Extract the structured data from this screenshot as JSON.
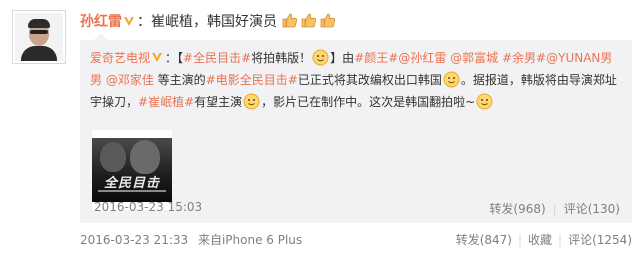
{
  "post": {
    "author": "孙红雷",
    "text": "：崔岷植，韩国好演员",
    "time": "2016-03-23 21:33",
    "source": "来自iPhone 6 Plus",
    "repost_label": "转发(847)",
    "collect_label": "收藏",
    "comment_label": "评论(1254)"
  },
  "repost": {
    "author": "爱奇艺电视",
    "segments": [
      {
        "t": "：【",
        "c": "plain"
      },
      {
        "t": "#全民目击#",
        "c": "link"
      },
      {
        "t": "将拍韩版！",
        "c": "plain"
      },
      {
        "t": "emoji",
        "c": "emoji"
      },
      {
        "t": "】由",
        "c": "plain"
      },
      {
        "t": "#颜王#",
        "c": "link"
      },
      {
        "t": "@孙红雷",
        "c": "link"
      },
      {
        "t": " ",
        "c": "plain"
      },
      {
        "t": "@郭富城",
        "c": "link"
      },
      {
        "t": " ",
        "c": "plain"
      },
      {
        "t": "#余男#",
        "c": "link"
      },
      {
        "t": "@YUNAN男男",
        "c": "link"
      },
      {
        "t": " ",
        "c": "plain"
      },
      {
        "t": "@邓家佳",
        "c": "link"
      },
      {
        "t": " 等主演的",
        "c": "plain"
      },
      {
        "t": "#电影全民目击#",
        "c": "link"
      },
      {
        "t": "已正式将其改编权出口韩国",
        "c": "plain"
      },
      {
        "t": "emoji",
        "c": "emoji"
      },
      {
        "t": "。据报道，韩版将由导演郑址宇操刀，",
        "c": "plain"
      },
      {
        "t": "#崔岷植#",
        "c": "link"
      },
      {
        "t": "有望主演",
        "c": "plain"
      },
      {
        "t": "emoji",
        "c": "emoji"
      },
      {
        "t": "，影片已在制作中。这次是韩国翻拍啦~",
        "c": "plain"
      },
      {
        "t": "emoji",
        "c": "emoji"
      }
    ],
    "image_title": "全民目击",
    "time": "2016-03-23 15:03",
    "repost_label": "转发(968)",
    "comment_label": "评论(130)"
  },
  "colors": {
    "accent": "#eb7350",
    "meta": "#808080",
    "repost_bg": "#f2f2f5"
  },
  "icons": {
    "verified": "v-badge-icon",
    "thumbs": "thumbs-up-icon"
  }
}
